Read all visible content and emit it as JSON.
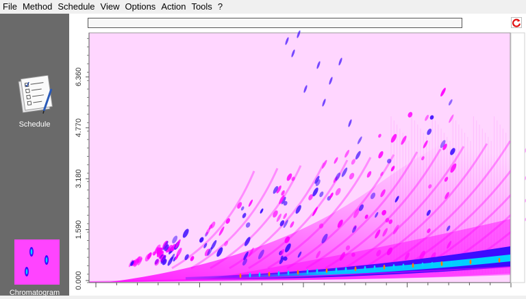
{
  "menu": {
    "items": [
      "File",
      "Method",
      "Schedule",
      "View",
      "Options",
      "Action",
      "Tools",
      "?"
    ]
  },
  "sidebar": {
    "schedule_label": "Schedule",
    "schedule_icon": "checklist-clipboard-icon",
    "chromatogram_label": "Chromatogram",
    "chromatogram_icon": "chromatogram-thumbnail-icon"
  },
  "toolbar": {
    "refresh_icon": "refresh-icon",
    "refresh_color": "#e01010"
  },
  "progress": {
    "fraction": 0.0
  },
  "plot": {
    "y_ticks": [
      "0.000",
      "1.590",
      "3.180",
      "4.770",
      "6.360"
    ],
    "background_color": "#ffd6ff",
    "colors": [
      "#ff00ff",
      "#3a0aff",
      "#00d4ff",
      "#ff8000"
    ]
  }
}
